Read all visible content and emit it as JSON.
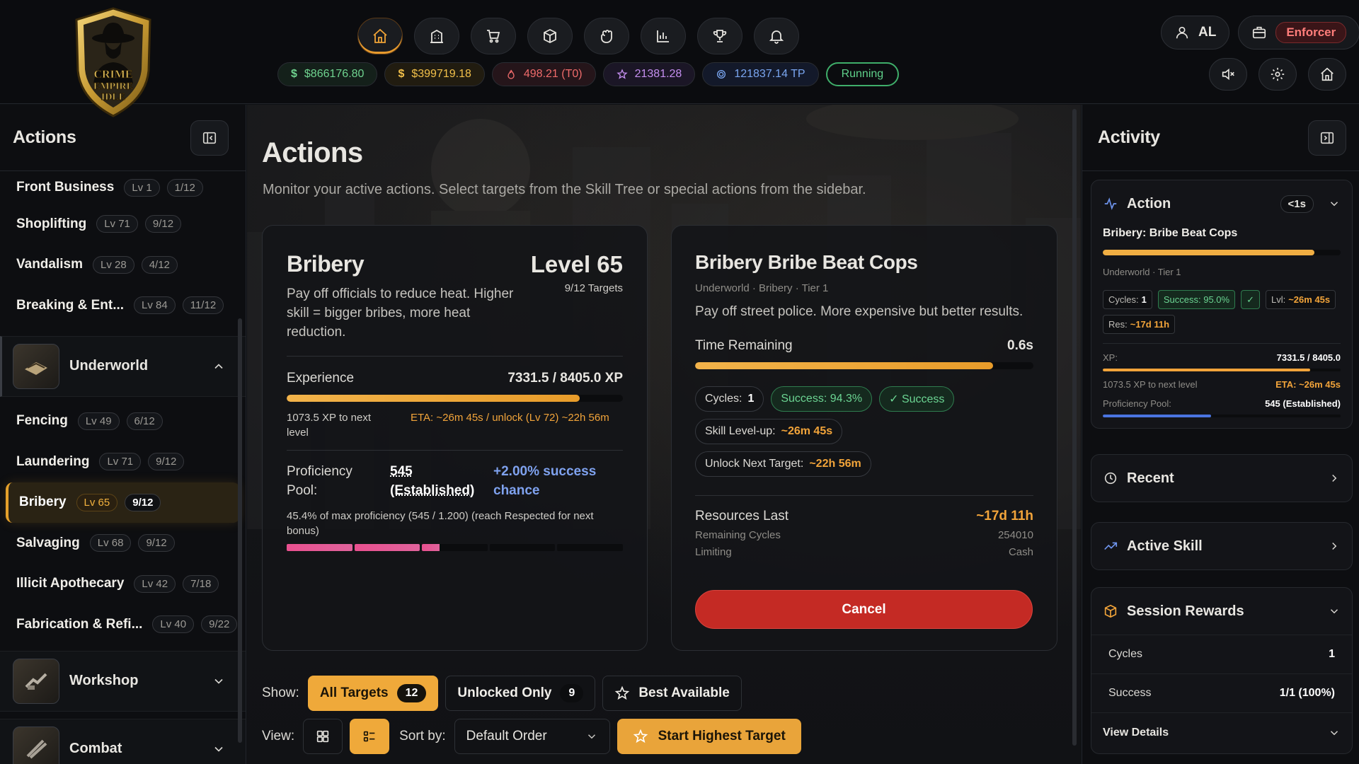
{
  "header": {
    "resources": {
      "cash": "$866176.80",
      "dirty": "$399719.18",
      "heat": "498.21 (T0)",
      "rep": "21381.28",
      "tp": "121837.14 TP",
      "status": "Running",
      "cash_icon": "$",
      "dirty_icon": "$"
    },
    "user_initials": "AL",
    "role": "Enforcer",
    "logo_text": [
      "CRIME",
      "EMPIRE",
      "IDLE"
    ]
  },
  "sidebar": {
    "title": "Actions",
    "top_items": [
      {
        "name": "Front Business",
        "lv": "Lv 1",
        "targets": "1/12"
      },
      {
        "name": "Shoplifting",
        "lv": "Lv 71",
        "targets": "9/12"
      },
      {
        "name": "Vandalism",
        "lv": "Lv 28",
        "targets": "4/12"
      },
      {
        "name": "Breaking & Ent...",
        "lv": "Lv 84",
        "targets": "11/12"
      }
    ],
    "category_underworld": "Underworld",
    "underworld_items": [
      {
        "name": "Fencing",
        "lv": "Lv 49",
        "targets": "6/12"
      },
      {
        "name": "Laundering",
        "lv": "Lv 71",
        "targets": "9/12"
      },
      {
        "name": "Bribery",
        "lv": "Lv 65",
        "targets": "9/12"
      },
      {
        "name": "Salvaging",
        "lv": "Lv 68",
        "targets": "9/12"
      },
      {
        "name": "Illicit Apothecary",
        "lv": "Lv 42",
        "targets": "7/18"
      },
      {
        "name": "Fabrication & Refi...",
        "lv": "Lv 40",
        "targets": "9/22"
      }
    ],
    "category_workshop": "Workshop",
    "category_combat": "Combat"
  },
  "main": {
    "title": "Actions",
    "subtitle": "Monitor your active actions. Select targets from the Skill Tree or special actions from the sidebar.",
    "skill": {
      "name": "Bribery",
      "level": "Level 65",
      "targets": "9/12 Targets",
      "desc": "Pay off officials to reduce heat. Higher skill = bigger bribes, more heat reduction.",
      "xp_label": "Experience",
      "xp_value": "7331.5 / 8405.0 XP",
      "xp_progress": 0.872,
      "xp_next": "1073.5 XP to next level",
      "eta": "ETA: ~26m 45s / unlock (Lv 72) ~22h 56m",
      "prof_label": "Proficiency Pool:",
      "prof_value": "545 (Established)",
      "prof_bonus": "+2.00% success chance",
      "prof_note": "45.4% of max proficiency (545 / 1.200) (reach Respected for next bonus)",
      "prof_progress": 0.454
    },
    "target": {
      "name": "Bribery Bribe Beat Cops",
      "meta": "Underworld · Bribery · Tier 1",
      "desc": "Pay off street police. More expensive but better results.",
      "time_label": "Time Remaining",
      "time_value": "0.6s",
      "time_progress": 0.88,
      "cycles_label": "Cycles:",
      "cycles_value": "1",
      "success_rate": "Success: 94.3%",
      "success_result": "✓ Success",
      "levelup_label": "Skill Level-up:",
      "levelup_value": "~26m 45s",
      "unlock_label": "Unlock Next Target:",
      "unlock_value": "~22h 56m",
      "resources_label": "Resources Last",
      "resources_value": "~17d 11h",
      "remaining_label": "Remaining Cycles",
      "remaining_value": "254010",
      "limiting_label": "Limiting",
      "limiting_value": "Cash",
      "cancel": "Cancel"
    },
    "filters": {
      "show_label": "Show:",
      "all_label": "All Targets",
      "all_count": "12",
      "unlocked_label": "Unlocked Only",
      "unlocked_count": "9",
      "best_label": "Best Available",
      "view_label": "View:",
      "sort_label": "Sort by:",
      "sort_value": "Default Order",
      "start_label": "Start Highest Target"
    }
  },
  "activity": {
    "title": "Activity",
    "action": {
      "title": "Action",
      "badge": "<1s",
      "name": "Bribery: Bribe Beat Cops",
      "progress": 0.89,
      "meta": "Underworld · Tier 1",
      "cycles_label": "Cycles:",
      "cycles_value": "1",
      "success": "Success: 95.0%",
      "check": "✓",
      "lvl_label": "Lvl:",
      "lvl_value": "~26m 45s",
      "res_label": "Res:",
      "res_value": "~17d 11h",
      "xp_label": "XP:",
      "xp_value": "7331.5 / 8405.0",
      "xp_progress": 0.872,
      "xp_next": "1073.5 XP to next level",
      "eta": "ETA: ~26m 45s",
      "pool_label": "Proficiency Pool:",
      "pool_value": "545 (Established)",
      "pool_progress": 0.454
    },
    "recent": "Recent",
    "active_skill": "Active Skill",
    "session": {
      "title": "Session Rewards",
      "cycles_label": "Cycles",
      "cycles_value": "1",
      "success_label": "Success",
      "success_value": "1/1 (100%)",
      "details": "View Details"
    }
  },
  "colors": {
    "accent": "#efa93a",
    "danger": "#c42a24",
    "success": "#3fae6a"
  }
}
